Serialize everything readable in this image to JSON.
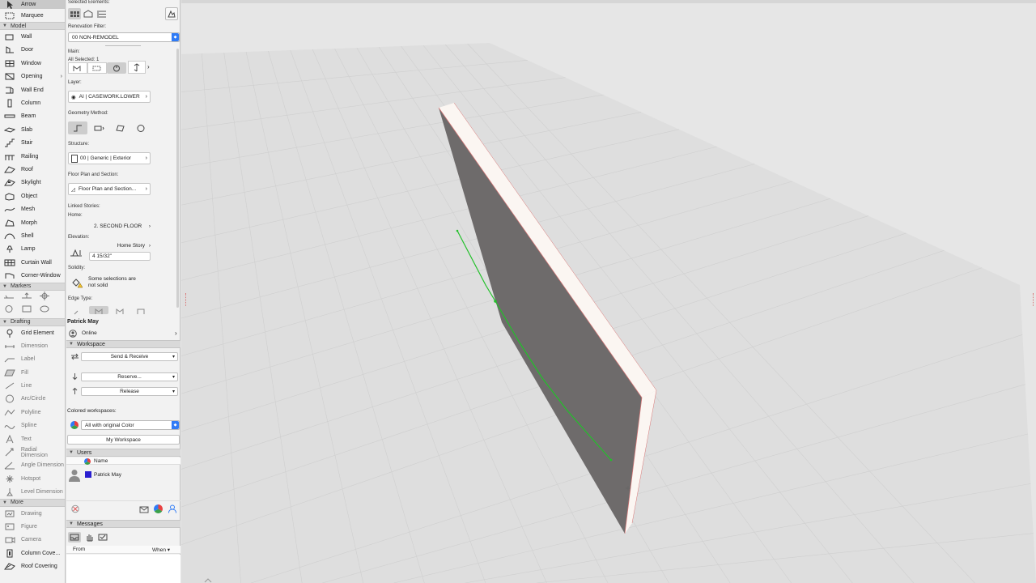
{
  "toolbox": {
    "top_items": [
      {
        "label": "Arrow",
        "icon": "arrow-icon",
        "selected": true
      },
      {
        "label": "Marquee",
        "icon": "marquee-icon"
      }
    ],
    "model_header": "Model",
    "model_items": [
      {
        "label": "Wall",
        "icon": "wall-icon"
      },
      {
        "label": "Door",
        "icon": "door-icon"
      },
      {
        "label": "Window",
        "icon": "window-icon"
      },
      {
        "label": "Opening",
        "icon": "opening-icon",
        "has_arrow": true
      },
      {
        "label": "Wall End",
        "icon": "wall-end-icon"
      },
      {
        "label": "Column",
        "icon": "column-icon"
      },
      {
        "label": "Beam",
        "icon": "beam-icon"
      },
      {
        "label": "Slab",
        "icon": "slab-icon"
      },
      {
        "label": "Stair",
        "icon": "stair-icon"
      },
      {
        "label": "Railing",
        "icon": "railing-icon"
      },
      {
        "label": "Roof",
        "icon": "roof-icon"
      },
      {
        "label": "Skylight",
        "icon": "skylight-icon"
      },
      {
        "label": "Object",
        "icon": "object-icon"
      },
      {
        "label": "Mesh",
        "icon": "mesh-icon"
      },
      {
        "label": "Morph",
        "icon": "morph-icon"
      },
      {
        "label": "Shell",
        "icon": "shell-icon"
      },
      {
        "label": "Lamp",
        "icon": "lamp-icon"
      },
      {
        "label": "Curtain Wall",
        "icon": "curtain-wall-icon"
      },
      {
        "label": "Corner-Window",
        "icon": "corner-window-icon"
      }
    ],
    "markers_header": "Markers",
    "drafting_header": "Drafting",
    "drafting_items": [
      {
        "label": "Grid Element",
        "icon": "grid-element-icon",
        "active": true
      },
      {
        "label": "Dimension",
        "icon": "dimension-icon"
      },
      {
        "label": "Label",
        "icon": "label-icon"
      },
      {
        "label": "Fill",
        "icon": "fill-icon"
      },
      {
        "label": "Line",
        "icon": "line-icon"
      },
      {
        "label": "Arc/Circle",
        "icon": "arc-circle-icon"
      },
      {
        "label": "Polyline",
        "icon": "polyline-icon"
      },
      {
        "label": "Spline",
        "icon": "spline-icon"
      },
      {
        "label": "Text",
        "icon": "text-icon"
      },
      {
        "label": "Radial Dimension",
        "icon": "radial-dimension-icon"
      },
      {
        "label": "Angle Dimension",
        "icon": "angle-dimension-icon"
      },
      {
        "label": "Hotspot",
        "icon": "hotspot-icon"
      },
      {
        "label": "Level Dimension",
        "icon": "level-dimension-icon"
      }
    ],
    "more_header": "More",
    "more_items": [
      {
        "label": "Drawing",
        "icon": "drawing-icon"
      },
      {
        "label": "Figure",
        "icon": "figure-icon"
      },
      {
        "label": "Camera",
        "icon": "camera-icon"
      },
      {
        "label": "Column Cove...",
        "icon": "column-cover-icon",
        "active": true
      },
      {
        "label": "Roof Covering",
        "icon": "roof-covering-icon",
        "active": true
      }
    ]
  },
  "infobox": {
    "selected_elements_label": "Selected Elements:",
    "renovation_filter_label": "Renovation Filter:",
    "renovation_filter_value": "00 NON-REMODEL",
    "main_label": "Main:",
    "all_selected": "All Selected: 1",
    "layer_label": "Layer:",
    "layer_value": "AI | CASEWORK.LOWER",
    "geometry_method_label": "Geometry Method:",
    "structure_label": "Structure:",
    "structure_value": "00 | Generic | Exterior",
    "floor_plan_label": "Floor Plan and Section:",
    "floor_plan_value": "Floor Plan and Section...",
    "linked_stories_label": "Linked Stories:",
    "home_label": "Home:",
    "home_value": "2. SECOND FLOOR",
    "elevation_label": "Elevation:",
    "elevation_ref": "Home Story",
    "elevation_value": "4 15/32\"",
    "solidity_label": "Solidity:",
    "solidity_value_1": "Some selections are",
    "solidity_value_2": "not solid",
    "edge_type_label": "Edge Type:"
  },
  "teamwork": {
    "user_name": "Patrick May",
    "status": "Online",
    "workspace_header": "Workspace",
    "send_receive": "Send & Receive",
    "reserve": "Reserve...",
    "release": "Release",
    "colored_label": "Colored workspaces:",
    "colored_value": "All with original Color",
    "my_workspace": "My Workspace",
    "users_header": "Users",
    "users_col_name": "Name",
    "users": [
      {
        "name": "Patrick May",
        "color": "#2a1fd0"
      }
    ],
    "messages_header": "Messages",
    "messages_col_from": "From",
    "messages_col_when": "When"
  },
  "colors": {
    "selection_green": "#22c02a",
    "wall_face_dark": "#6e6b6b",
    "wall_face_light": "#fbf6f2",
    "grid_line": "#cfcfcf",
    "ground": "#dedede",
    "accent_blue": "#2f7bf6"
  }
}
